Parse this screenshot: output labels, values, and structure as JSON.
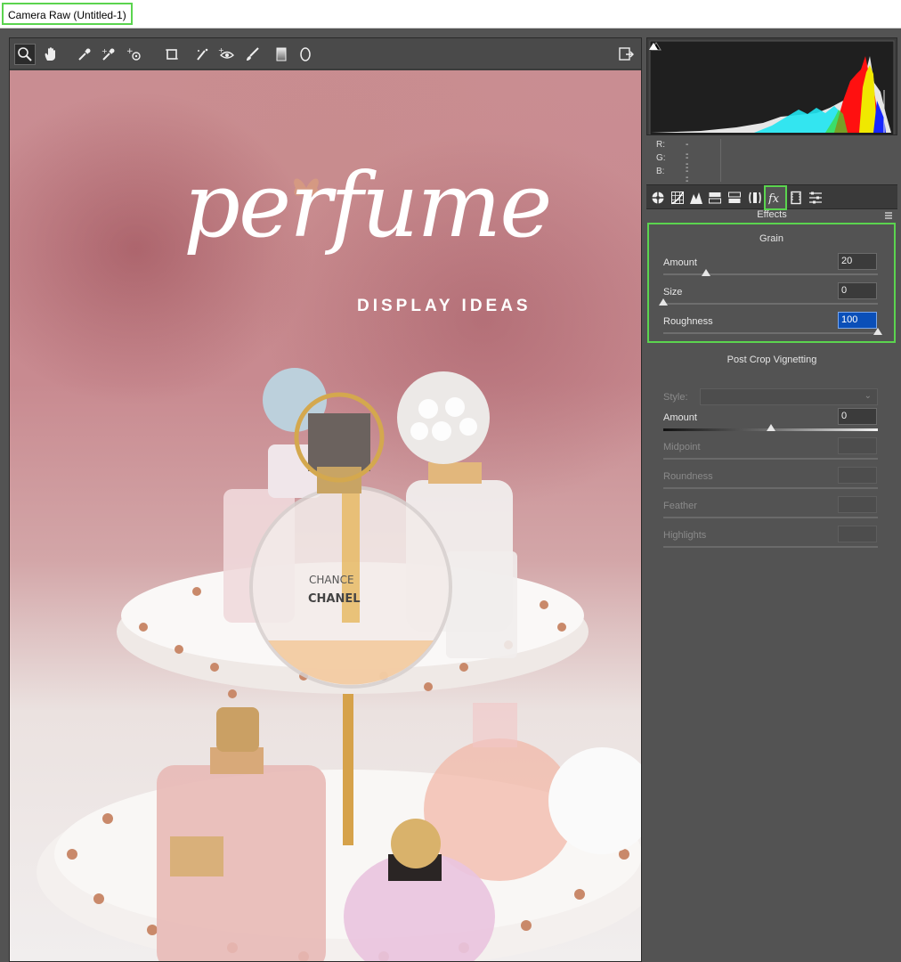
{
  "window": {
    "title": "Camera Raw (Untitled-1)"
  },
  "toolbar": {
    "tools": [
      "zoom-tool",
      "hand-tool",
      "white-balance-tool",
      "color-sampler-tool",
      "targeted-adjustment-tool",
      "crop-tool",
      "straighten-tool",
      "spot-removal-tool",
      "red-eye-tool",
      "adjustment-brush",
      "graduated-filter",
      "radial-filter"
    ],
    "active_tool": "zoom-tool"
  },
  "photo": {
    "title": "perfume",
    "subtitle": "DISPLAY IDEAS",
    "label_1": "CHANCE",
    "label_2": "CHANEL"
  },
  "histogram": {
    "r_label": "R:",
    "g_label": "G:",
    "b_label": "B:",
    "r_value": "---",
    "g_value": "---",
    "b_value": "---"
  },
  "tabs": {
    "items": [
      "basic",
      "tone-curve",
      "detail",
      "hsl",
      "split-toning",
      "lens-corrections",
      "effects",
      "camera-calibration",
      "presets"
    ],
    "active": "effects"
  },
  "effects": {
    "header": "Effects",
    "grain": {
      "title": "Grain",
      "amount_label": "Amount",
      "amount_value": "20",
      "amount_level": 0.2,
      "size_label": "Size",
      "size_value": "0",
      "size_level": 0.0,
      "roughness_label": "Roughness",
      "roughness_value": "100",
      "roughness_level": 1.0
    },
    "vignetting": {
      "title": "Post Crop Vignetting",
      "style_label": "Style:",
      "style_value": "",
      "amount_label": "Amount",
      "amount_value": "0",
      "amount_level": 0.5,
      "midpoint_label": "Midpoint",
      "roundness_label": "Roundness",
      "feather_label": "Feather",
      "highlights_label": "Highlights"
    }
  },
  "colors": {
    "accent_highlight": "#5bd44f",
    "panel_bg": "#535353",
    "selection": "#0a4fb8"
  }
}
